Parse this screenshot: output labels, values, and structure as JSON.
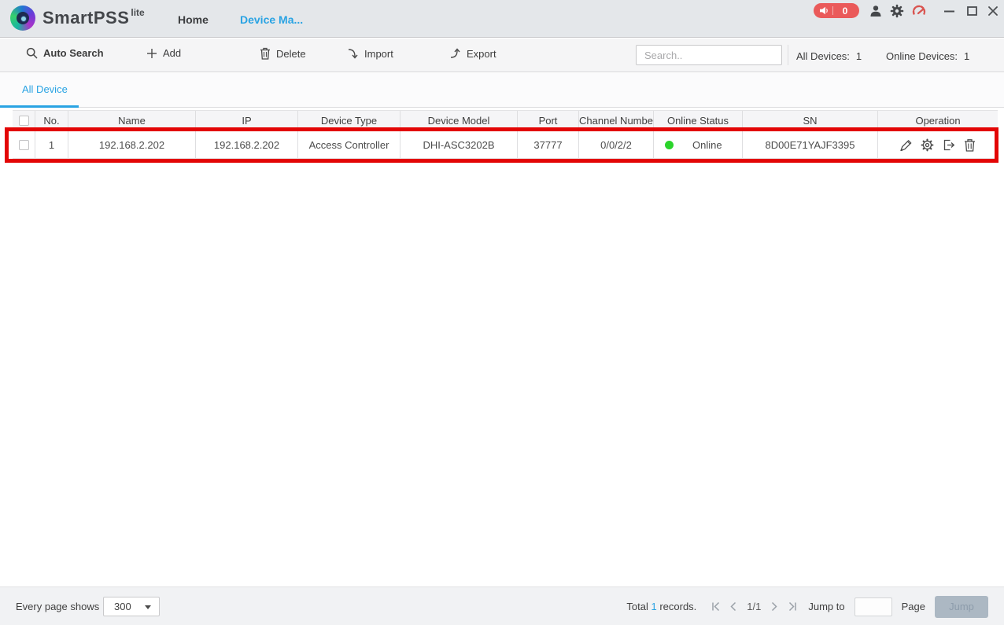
{
  "titlebar": {
    "app_name": "SmartPSS",
    "app_badge": "lite",
    "tabs": [
      {
        "label": "Home",
        "active": false
      },
      {
        "label": "Device Ma...",
        "active": true
      }
    ],
    "notification_count": "0"
  },
  "toolbar": {
    "auto_search_label": "Auto Search",
    "add_label": "Add",
    "delete_label": "Delete",
    "import_label": "Import",
    "export_label": "Export",
    "search_placeholder": "Search..",
    "all_devices_label": "All Devices:",
    "all_devices_count": "1",
    "online_devices_label": "Online Devices:",
    "online_devices_count": "1"
  },
  "view_tabs": {
    "all_device_label": "All Device"
  },
  "table": {
    "headers": [
      "No.",
      "Name",
      "IP",
      "Device Type",
      "Device Model",
      "Port",
      "Channel Numbe",
      "Online Status",
      "SN",
      "Operation"
    ],
    "rows": [
      {
        "no": "1",
        "name": "192.168.2.202",
        "ip": "192.168.2.202",
        "device_type": "Access Controller",
        "device_model": "DHI-ASC3202B",
        "port": "37777",
        "channel_number": "0/0/2/2",
        "online_status": "Online",
        "sn": "8D00E71YAJF3395"
      }
    ]
  },
  "pagination": {
    "every_page_shows_label": "Every page shows",
    "page_size": "300",
    "total_prefix": "Total",
    "total_count": "1",
    "total_suffix": "records.",
    "page_indicator": "1/1",
    "jump_to_label": "Jump to",
    "page_label": "Page",
    "jump_button_label": "Jump"
  },
  "colors": {
    "accent_blue": "#29a3e3",
    "online_green": "#2bd42b",
    "highlight_red": "#e30505",
    "notification_red": "#ea5a5a",
    "gauge_red": "#d9534f"
  },
  "icons": {
    "logo": "smartpss-logo",
    "titlebar": [
      "speaker-icon",
      "user-icon",
      "gear-icon",
      "gauge-icon",
      "minimize-icon",
      "maximize-icon",
      "close-icon"
    ],
    "toolbar": [
      "search-icon",
      "plus-icon",
      "trash-icon",
      "import-arrow-icon",
      "export-arrow-icon",
      "magnifier-icon"
    ],
    "operation": [
      "edit-pencil-icon",
      "config-gear-icon",
      "logout-icon",
      "delete-trash-icon"
    ],
    "pagination": [
      "first-page-icon",
      "prev-page-icon",
      "next-page-icon",
      "last-page-icon"
    ]
  }
}
